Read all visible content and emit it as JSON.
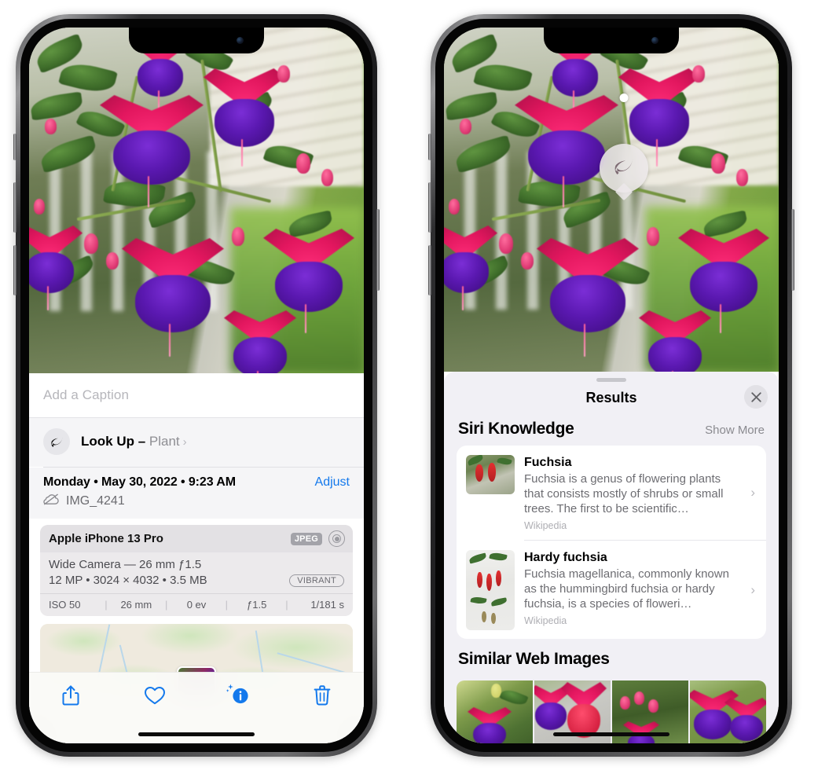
{
  "left_phone": {
    "photo": {
      "alt_name": "fuchsia-flowers-photo"
    },
    "caption": {
      "placeholder": "Add a Caption",
      "value": ""
    },
    "lookup": {
      "icon": "leaf-icon",
      "label": "Look Up – ",
      "subject": "Plant",
      "chevron": "›"
    },
    "metadata": {
      "date": "Monday • May 30, 2022 • 9:23 AM",
      "adjust_label": "Adjust",
      "cloud_icon": "cloud-slash-icon",
      "filename": "IMG_4241"
    },
    "camera_card": {
      "model": "Apple iPhone 13 Pro",
      "format_badge": "JPEG",
      "raw_icon": "aperture-icon",
      "lens": "Wide Camera — 26 mm ƒ1.5",
      "specs": "12 MP • 3024 × 4032 • 3.5 MB",
      "style_badge": "VIBRANT",
      "exif": [
        "ISO 50",
        "26 mm",
        "0 ev",
        "ƒ1.5",
        "1/181 s"
      ],
      "exif_divider": "|"
    },
    "map": {
      "name": "location-map-thumbnail"
    },
    "toolbar": [
      {
        "name": "share-button",
        "icon": "share-icon"
      },
      {
        "name": "favorite-button",
        "icon": "heart-icon"
      },
      {
        "name": "info-button",
        "icon": "info-sparkle-icon"
      },
      {
        "name": "delete-button",
        "icon": "trash-icon"
      }
    ],
    "accent_color": "#1479ec"
  },
  "right_phone": {
    "photo_badge": {
      "icon": "leaf-icon",
      "name": "visual-lookup-badge"
    },
    "sheet": {
      "title": "Results",
      "close_icon": "close-icon"
    },
    "siri_knowledge": {
      "heading": "Siri Knowledge",
      "show_more": "Show More",
      "items": [
        {
          "title": "Fuchsia",
          "description": "Fuchsia is a genus of flowering plants that consists mostly of shrubs or small trees. The first to be scientific…",
          "source": "Wikipedia",
          "chevron": "›"
        },
        {
          "title": "Hardy fuchsia",
          "description": "Fuchsia magellanica, commonly known as the hummingbird fuchsia or hardy fuchsia, is a species of floweri…",
          "source": "Wikipedia",
          "chevron": "›"
        }
      ]
    },
    "similar_web_images": {
      "heading": "Similar Web Images",
      "thumbnails": [
        {
          "name": "web-image-1"
        },
        {
          "name": "web-image-2"
        },
        {
          "name": "web-image-3"
        },
        {
          "name": "web-image-4"
        }
      ]
    }
  }
}
